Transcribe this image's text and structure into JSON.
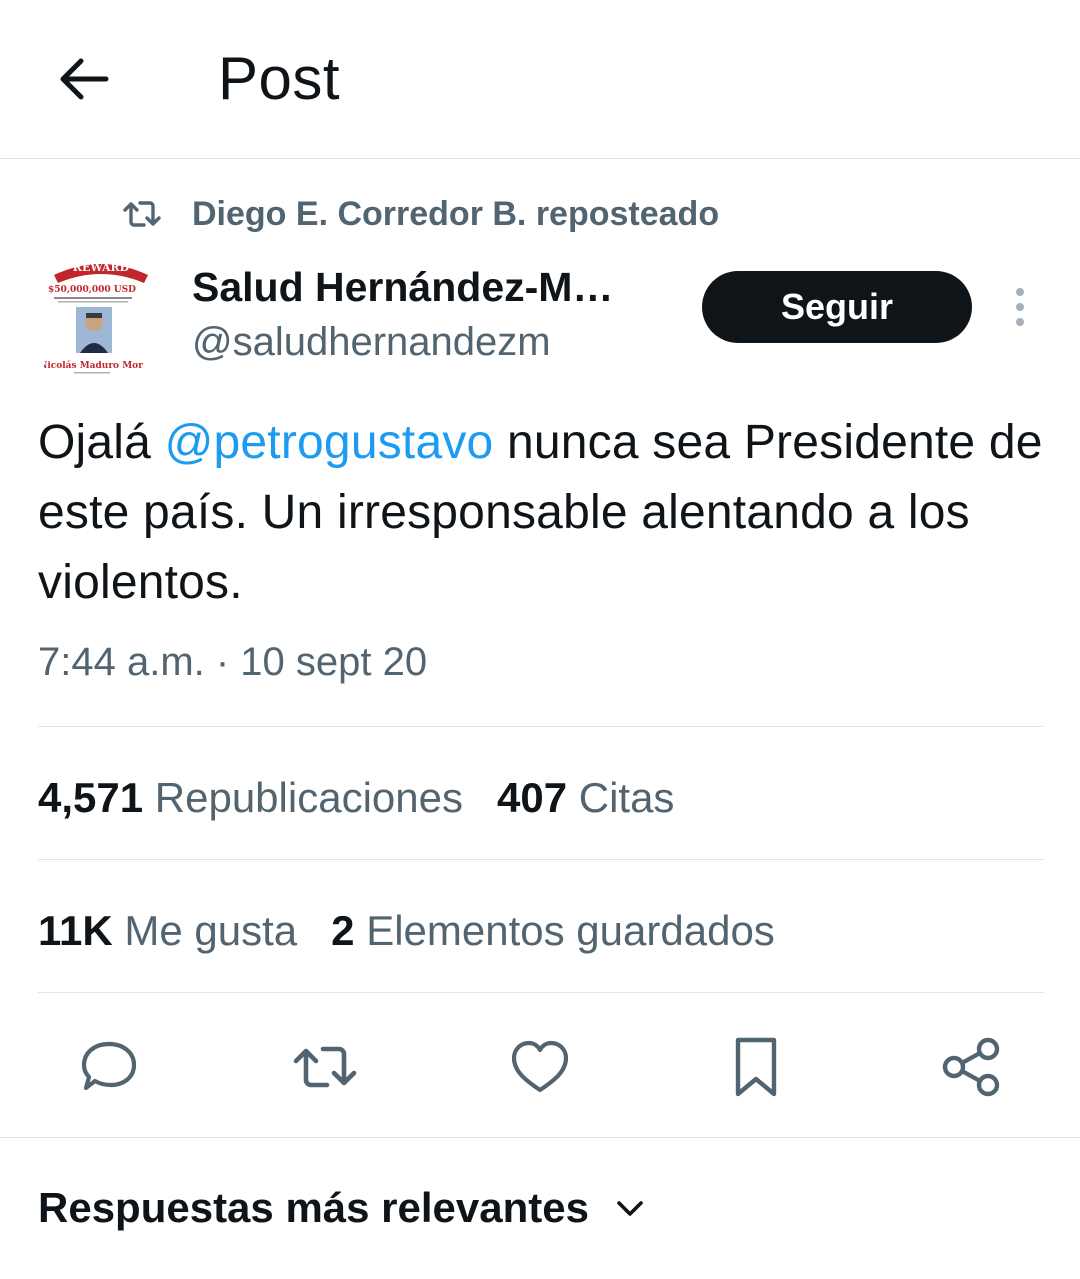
{
  "header": {
    "title": "Post",
    "back_icon": "arrow-left-icon"
  },
  "repost": {
    "icon": "repost-icon",
    "text": "Diego E. Corredor B. reposteado"
  },
  "author": {
    "name": "Salud Hernández-M…",
    "handle": "@saludhernandezm",
    "avatar": {
      "banner_text": "REWARD",
      "amount_text": "$50,000,000 USD",
      "caption_text": "Nicolás Maduro Mor"
    }
  },
  "follow_button": {
    "label": "Seguir"
  },
  "more_icon": "more-vertical-icon",
  "tweet": {
    "text_before": "Ojalá ",
    "mention": "@petrogustavo",
    "text_after": " nunca sea Presidente de este país. Un irresponsable alentando a los violentos.",
    "timestamp": "7:44 a.m. · 10 sept 20"
  },
  "stats": {
    "reposts_count": "4,571",
    "reposts_label": " Republicaciones",
    "quotes_count": "407",
    "quotes_label": " Citas",
    "likes_count": "11K",
    "likes_label": " Me gusta",
    "bookmarks_count": "2",
    "bookmarks_label": " Elementos guardados"
  },
  "actions": [
    "reply-icon",
    "repost-icon",
    "like-icon",
    "bookmark-icon",
    "share-icon"
  ],
  "replies_sort": {
    "label": "Respuestas más relevantes",
    "icon": "chevron-down-icon"
  },
  "colors": {
    "text": "#0f1419",
    "secondary": "#536471",
    "link": "#1d9bf0",
    "divider": "#e1e4e8",
    "button": "#0f1419"
  }
}
